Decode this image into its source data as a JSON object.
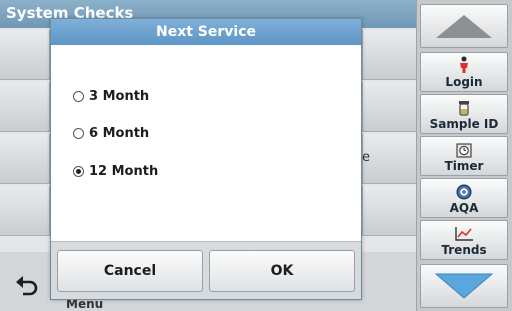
{
  "background": {
    "title": "System Checks",
    "right_glyph": "e",
    "menu_label": "Menu"
  },
  "dialog": {
    "title": "Next Service",
    "options": [
      {
        "label": "3 Month",
        "selected": false
      },
      {
        "label": "6 Month",
        "selected": false
      },
      {
        "label": "12 Month",
        "selected": true
      }
    ],
    "cancel_label": "Cancel",
    "ok_label": "OK"
  },
  "side_panel": {
    "buttons": [
      {
        "label": "Login",
        "icon": "person-icon"
      },
      {
        "label": "Sample ID",
        "icon": "sample-vial-icon"
      },
      {
        "label": "Timer",
        "icon": "timer-icon"
      },
      {
        "label": "AQA",
        "icon": "aqa-icon"
      },
      {
        "label": "Trends",
        "icon": "trend-chart-icon"
      }
    ],
    "up_icon": "arrow-up-icon",
    "down_icon": "arrow-down-icon"
  },
  "colors": {
    "title_bar": "#5d95c4",
    "arrow_up": "#8c9093",
    "arrow_down": "#5aa7dd",
    "accent_red": "#d9322b"
  }
}
